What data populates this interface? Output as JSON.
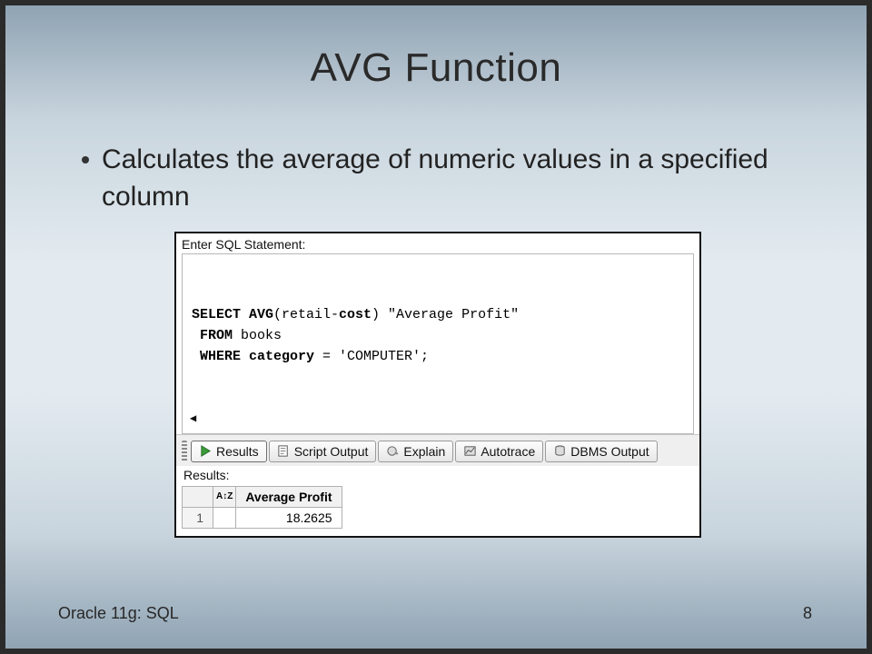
{
  "slide": {
    "title": "AVG Function",
    "bullet": "Calculates the average of numeric values in a specified column",
    "footer_left": "Oracle 11g: SQL",
    "page_number": "8"
  },
  "sqlpanel": {
    "enter_label": "Enter SQL Statement:",
    "sql_lines": [
      {
        "tokens": [
          {
            "t": "SELECT AVG",
            "b": true
          },
          {
            "t": "(retail-",
            "b": false
          },
          {
            "t": "cost",
            "b": true
          },
          {
            "t": ") \"Average Profit\"",
            "b": false
          }
        ]
      },
      {
        "tokens": [
          {
            "t": " FROM ",
            "b": true
          },
          {
            "t": "books",
            "b": false
          }
        ]
      },
      {
        "tokens": [
          {
            "t": " WHERE category ",
            "b": true
          },
          {
            "t": "= 'COMPUTER';",
            "b": false
          }
        ]
      }
    ],
    "scroll_hint": "◀",
    "tabs": {
      "results": {
        "label": "Results",
        "icon": "play-icon"
      },
      "script": {
        "label": "Script Output",
        "icon": "script-icon"
      },
      "explain": {
        "label": "Explain",
        "icon": "explain-icon"
      },
      "autotrace": {
        "label": "Autotrace",
        "icon": "autotrace-icon"
      },
      "dbms": {
        "label": "DBMS Output",
        "icon": "dbms-icon"
      }
    },
    "results_label": "Results:",
    "grid": {
      "az_label": "A↕Z",
      "column_header": "Average Profit",
      "rows": [
        {
          "n": "1",
          "value": "18.2625"
        }
      ]
    }
  }
}
